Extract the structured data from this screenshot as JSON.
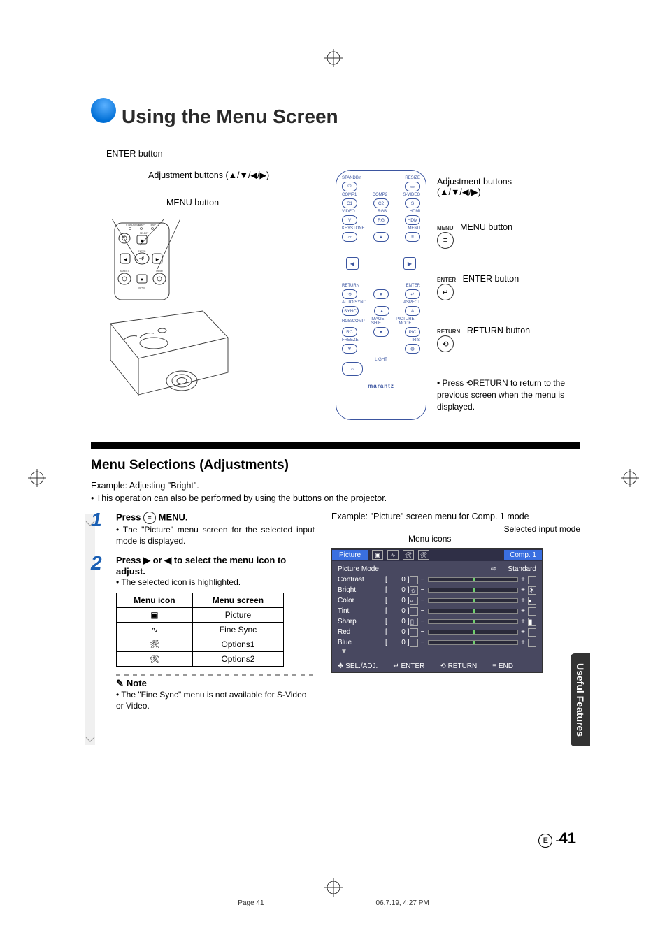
{
  "page_title": "Using the Menu Screen",
  "diagram": {
    "enter_button_label": "ENTER button",
    "adjustment_buttons_label": "Adjustment buttons (▲/▼/◀/▶)",
    "menu_button_label": "MENU button",
    "right": {
      "adjustment_buttons": "Adjustment buttons",
      "adjustment_buttons_sub": "(▲/▼/◀/▶)",
      "menu_label_small": "MENU",
      "menu_button": "MENU button",
      "enter_label_small": "ENTER",
      "enter_button": "ENTER button",
      "return_label_small": "RETURN",
      "return_button": "RETURN button",
      "return_note": "Press ⟲RETURN to return to the previous screen when the menu is displayed."
    },
    "remote": {
      "standby": "STANDBY",
      "resize": "RESIZE",
      "comp1": "COMP1",
      "comp2": "COMP2",
      "svideo": "S-VIDEO",
      "c1": "C1",
      "c2": "C2",
      "s": "S",
      "video": "VIDEO",
      "rgb": "RGB",
      "hdmi": "HDMI",
      "v": "V",
      "rg": "RG",
      "hdm": "HDM",
      "keystone": "KEYSTONE",
      "menu": "MENU",
      "return": "RETURN",
      "enter": "ENTER",
      "autosync": "AUTO SYNC",
      "aspect": "ASPECT",
      "sync": "SYNC",
      "a": "A",
      "rgbcomp": "RGB/COMP",
      "imageshift": "IMAGE SHIFT",
      "picturemode": "PICTURE MODE",
      "rc": "RC",
      "pic": "PIC",
      "freeze": "FREEZE",
      "iris": "IRIS",
      "light": "LIGHT",
      "brand": "marantz"
    },
    "projector_top": {
      "standby_on": "STANDBY/ON",
      "lamp": "LAMP",
      "temp": "TEMP",
      "aspect": "ASPECT",
      "menu": "MENU",
      "enter": "ENTER",
      "input": "INPUT",
      "select": "SELECT"
    }
  },
  "menu_selections_title": "Menu Selections (Adjustments)",
  "intro_line1": "Example: Adjusting \"Bright\".",
  "intro_line2": "• This operation can also be performed by using the buttons on the projector.",
  "steps": [
    {
      "num": "1",
      "head_prefix": "Press ",
      "head_suffix": " MENU.",
      "body": "• The \"Picture\" menu screen for the selected input mode is displayed."
    },
    {
      "num": "2",
      "head": "Press ▶ or ◀ to select the menu icon to adjust.",
      "body": "• The selected icon is highlighted."
    }
  ],
  "icon_table": {
    "head_icon": "Menu icon",
    "head_screen": "Menu screen",
    "rows": [
      {
        "screen": "Picture"
      },
      {
        "screen": "Fine Sync"
      },
      {
        "screen": "Options1"
      },
      {
        "screen": "Options2"
      }
    ]
  },
  "note": {
    "label": "Note",
    "body": "• The \"Fine Sync\" menu is not available for S-Video or Video."
  },
  "osd_example": {
    "caption": "Example: \"Picture\" screen menu for Comp. 1 mode",
    "selected_input_label": "Selected input mode",
    "menu_icons_label": "Menu icons",
    "tab": "Picture",
    "input": "Comp. 1",
    "rows": [
      {
        "name": "Picture Mode",
        "mode": "Standard"
      },
      {
        "name": "Contrast",
        "val": "0"
      },
      {
        "name": "Bright",
        "val": "0"
      },
      {
        "name": "Color",
        "val": "0"
      },
      {
        "name": "Tint",
        "val": "0"
      },
      {
        "name": "Sharp",
        "val": "0"
      },
      {
        "name": "Red",
        "val": "0"
      },
      {
        "name": "Blue",
        "val": "0"
      }
    ],
    "foot": {
      "sel": "SEL./ADJ.",
      "enter": "ENTER",
      "return": "RETURN",
      "end": "END"
    }
  },
  "side_tab": "Useful\nFeatures",
  "page_number": "41",
  "footer_page": "Page 41",
  "footer_ts": "06.7.19, 4:27 PM"
}
